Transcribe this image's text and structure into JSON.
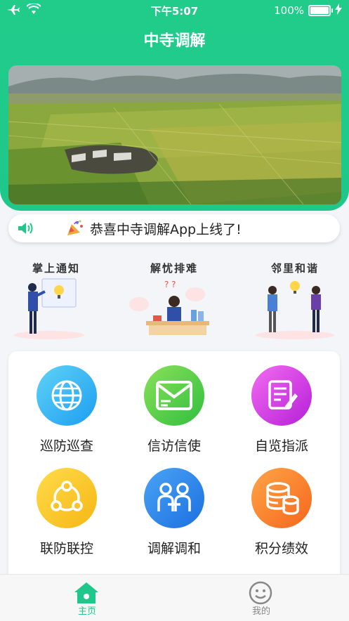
{
  "status": {
    "time": "下午5:07",
    "battery": "100%"
  },
  "app_title": "中寺调解",
  "notice": {
    "text": "恭喜中寺调解App上线了!"
  },
  "features": [
    {
      "label": "掌上通知"
    },
    {
      "label": "解忧排难"
    },
    {
      "label": "邻里和谐"
    }
  ],
  "grid": [
    {
      "label": "巡防巡查",
      "icon": "globe-icon",
      "color_from": "#5fd3f7",
      "color_to": "#1e9df0"
    },
    {
      "label": "信访信使",
      "icon": "mail-icon",
      "color_from": "#8be05a",
      "color_to": "#2fbf3e"
    },
    {
      "label": "自览指派",
      "icon": "document-edit-icon",
      "color_from": "#f36cf0",
      "color_to": "#b51fd8"
    },
    {
      "label": "联防联控",
      "icon": "network-icon",
      "color_from": "#ffdc4a",
      "color_to": "#f6b614"
    },
    {
      "label": "调解调和",
      "icon": "people-icon",
      "color_from": "#4aa4f5",
      "color_to": "#1c6fe0"
    },
    {
      "label": "积分绩效",
      "icon": "coins-icon",
      "color_from": "#ffa546",
      "color_to": "#f5661d"
    }
  ],
  "tabs": [
    {
      "label": "主页",
      "icon": "home-icon",
      "active": true
    },
    {
      "label": "我的",
      "icon": "smiley-icon",
      "active": false
    }
  ],
  "colors": {
    "brand": "#1fc88a",
    "tab_active": "#1fc88a",
    "tab_inactive": "#888888"
  }
}
